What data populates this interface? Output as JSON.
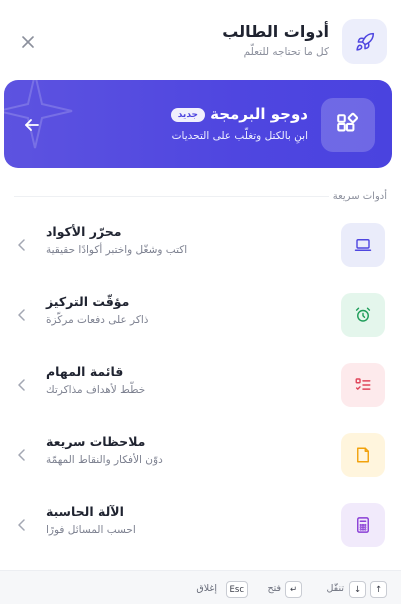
{
  "header": {
    "title": "أدوات الطالب",
    "subtitle": "كل ما تحتاجه للتعلّم",
    "app_icon": "rocket-icon",
    "close_icon": "close-icon"
  },
  "promo": {
    "title": "دوجو البرمجة",
    "badge": "جديد",
    "description": "ابنِ بالكتل وتغلّب على التحديات",
    "icon": "blocks-icon",
    "arrow_icon": "arrow-left-icon",
    "colors": {
      "background": "#5048e0",
      "text": "#ffffff"
    }
  },
  "section": {
    "label": "أدوات سريعة"
  },
  "tools": [
    {
      "title": "محرّر الأكواد",
      "description": "اكتب وشغّل واختبر أكوادًا حقيقية",
      "icon": "laptop-icon",
      "icon_bg": "#eaecfa",
      "icon_color": "#4f46e0"
    },
    {
      "title": "مؤقّت التركيز",
      "description": "ذاكر على دفعات مركّزة",
      "icon": "alarm-clock-icon",
      "icon_bg": "#e4f6ec",
      "icon_color": "#1f9d5a"
    },
    {
      "title": "قائمة المهام",
      "description": "خطّط لأهداف مذاكرتك",
      "icon": "checklist-icon",
      "icon_bg": "#fdeaec",
      "icon_color": "#e0445a"
    },
    {
      "title": "ملاحظات سريعة",
      "description": "دوّن الأفكار والنقاط المهمّة",
      "icon": "note-icon",
      "icon_bg": "#fff5dd",
      "icon_color": "#f2a20c"
    },
    {
      "title": "الآلة الحاسبة",
      "description": "احسب المسائل فورًا",
      "icon": "calculator-icon",
      "icon_bg": "#f1eafb",
      "icon_color": "#8a3fd6"
    }
  ],
  "footer": {
    "navigate_label": "تنقّل",
    "open_label": "فتح",
    "close_label": "إغلاق",
    "key_up": "↑",
    "key_down": "↓",
    "key_enter": "↵",
    "key_esc": "Esc"
  }
}
